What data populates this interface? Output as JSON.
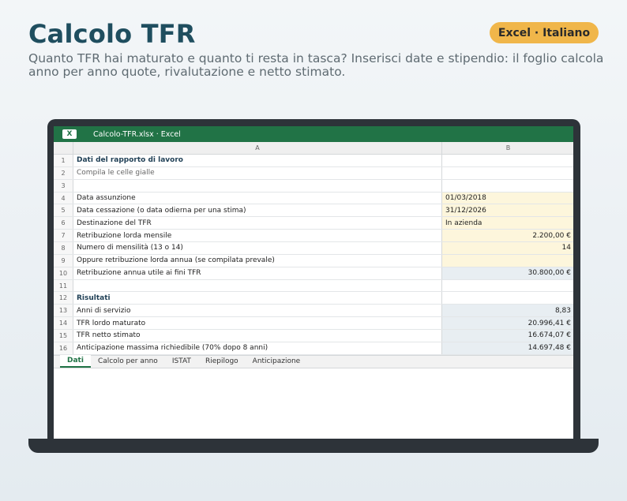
{
  "header": {
    "title": "Calcolo TFR",
    "badge": "Excel · Italiano",
    "subtitle": "Quanto TFR hai maturato e quanto ti resta in tasca? Inserisci date e stipendio: il foglio calcola anno per anno quote, rivalutazione e netto stimato."
  },
  "window": {
    "app_icon": "X",
    "title": "Calcolo-TFR.xlsx · Excel"
  },
  "sheet": {
    "col_a": "A",
    "col_b": "B",
    "rows": [
      {
        "n": "1",
        "a": "Dati del rapporto di lavoro",
        "b": ""
      },
      {
        "n": "2",
        "a": "Compila le celle gialle",
        "b": ""
      },
      {
        "n": "3",
        "a": "",
        "b": ""
      },
      {
        "n": "4",
        "a": "Data assunzione",
        "b": "01/03/2018"
      },
      {
        "n": "5",
        "a": "Data cessazione (o data odierna per una stima)",
        "b": "31/12/2026"
      },
      {
        "n": "6",
        "a": "Destinazione del TFR",
        "b": "In azienda"
      },
      {
        "n": "7",
        "a": "Retribuzione lorda mensile",
        "b": "2.200,00 €"
      },
      {
        "n": "8",
        "a": "Numero di mensilità (13 o 14)",
        "b": "14"
      },
      {
        "n": "9",
        "a": "Oppure retribuzione lorda annua (se compilata prevale)",
        "b": ""
      },
      {
        "n": "10",
        "a": "Retribuzione annua utile ai fini TFR",
        "b": "30.800,00 €"
      },
      {
        "n": "11",
        "a": "",
        "b": ""
      },
      {
        "n": "12",
        "a": "Risultati",
        "b": ""
      },
      {
        "n": "13",
        "a": "Anni di servizio",
        "b": "8,83"
      },
      {
        "n": "14",
        "a": "TFR lordo maturato",
        "b": "20.996,41 €"
      },
      {
        "n": "15",
        "a": "TFR netto stimato",
        "b": "16.674,07 €"
      },
      {
        "n": "16",
        "a": "Anticipazione massima richiedibile (70% dopo 8 anni)",
        "b": "14.697,48 €"
      }
    ]
  },
  "tabs": [
    "Dati",
    "Calcolo per anno",
    "ISTAT",
    "Riepilogo",
    "Anticipazione"
  ],
  "colors": {
    "brand": "#1f4e5f",
    "excel_green": "#217346",
    "badge": "#f0b64a",
    "input_cell": "#fdf6dc",
    "calc_cell": "#e8eef2"
  }
}
